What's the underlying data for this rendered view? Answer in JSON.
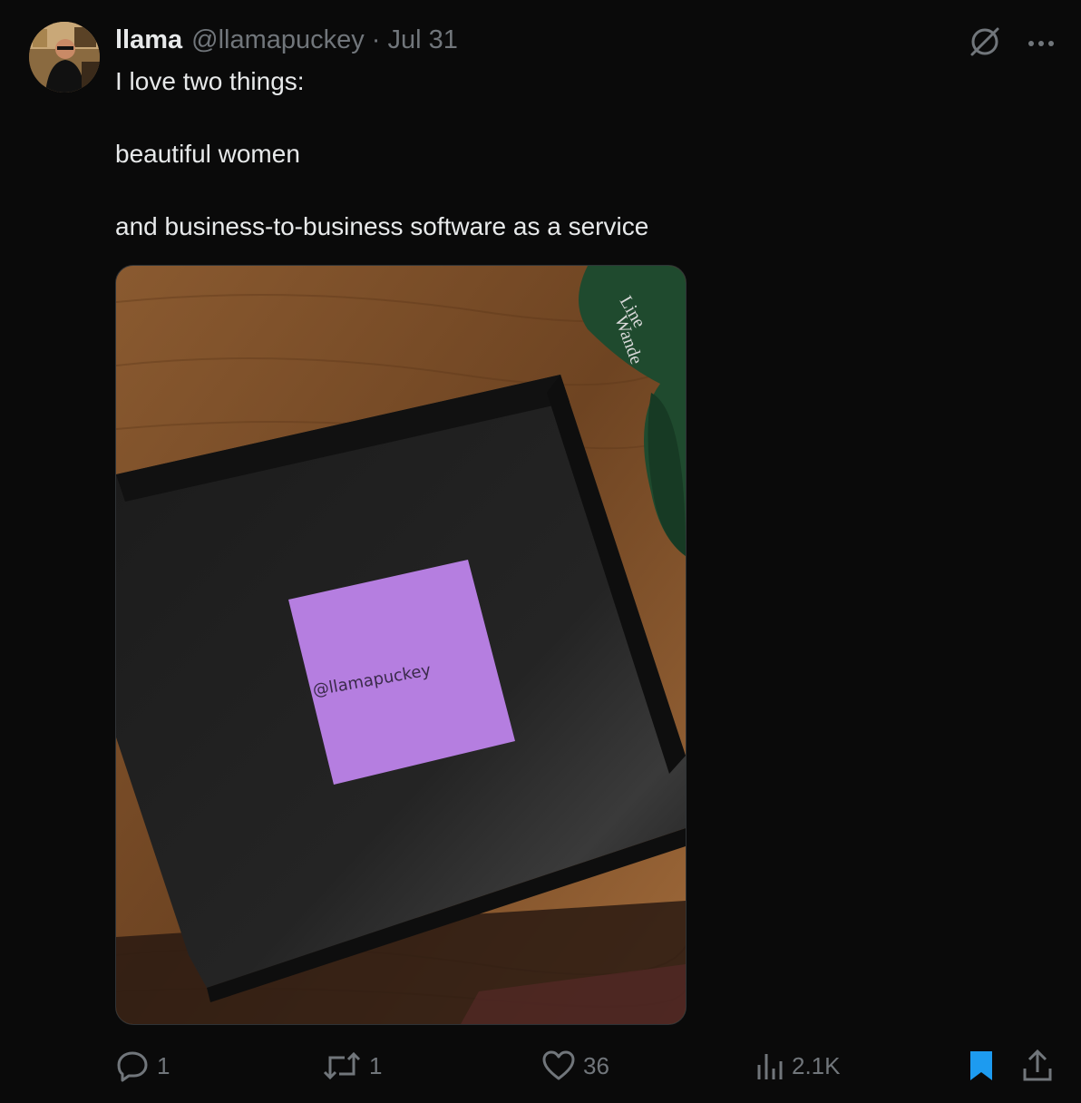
{
  "tweet": {
    "author": {
      "name": "llama",
      "handle": "@llamapuckey",
      "separator": "·",
      "date": "Jul 31"
    },
    "text_lines": [
      "I love two things:",
      "beautiful women",
      "and business-to-business software as a service"
    ],
    "image": {
      "note_text": "@llamapuckey",
      "cap_text_1": "Line",
      "cap_text_2": "Wande"
    },
    "stats": {
      "replies": "1",
      "reposts": "1",
      "likes": "36",
      "views": "2.1K"
    },
    "icons": {
      "grok": "slashed-circle-icon",
      "more": "more-dots-icon",
      "reply": "reply-icon",
      "repost": "repost-icon",
      "like": "heart-icon",
      "views": "views-icon",
      "bookmark": "bookmark-icon",
      "share": "share-icon"
    },
    "colors": {
      "background": "#0a0a0a",
      "muted": "#71767b",
      "text": "#e7e9ea",
      "bookmark_active": "#1d9bf0",
      "sticky_note": "#b57ee0"
    }
  }
}
